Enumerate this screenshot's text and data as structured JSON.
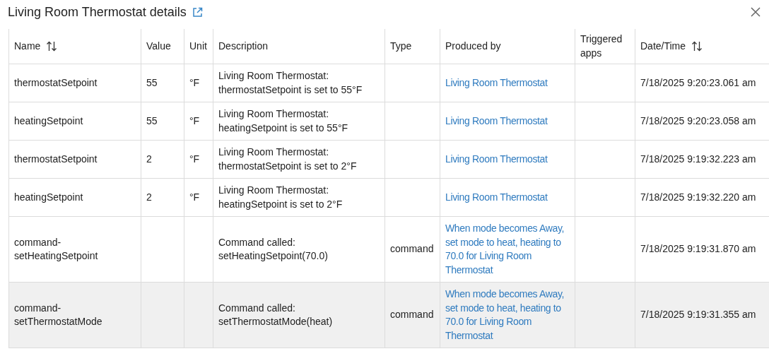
{
  "dialog": {
    "title": "Living Room Thermostat details"
  },
  "table": {
    "columns": [
      {
        "label": "Name",
        "sortable": true
      },
      {
        "label": "Value",
        "sortable": false
      },
      {
        "label": "Unit",
        "sortable": false
      },
      {
        "label": "Description",
        "sortable": false
      },
      {
        "label": "Type",
        "sortable": false
      },
      {
        "label": "Produced by",
        "sortable": false
      },
      {
        "label": "Triggered apps",
        "sortable": false
      },
      {
        "label": "Date/Time",
        "sortable": true
      }
    ],
    "rows": [
      {
        "name": "thermostatSetpoint",
        "value": "55",
        "unit": "°F",
        "description": "Living Room Thermostat: thermostatSetpoint is set to 55°F",
        "type": "",
        "produced_by": "Living Room Thermostat",
        "date_time": "7/18/2025 9:20:23.061 am",
        "highlighted": false
      },
      {
        "name": "heatingSetpoint",
        "value": "55",
        "unit": "°F",
        "description": "Living Room Thermostat: heatingSetpoint is set to 55°F",
        "type": "",
        "produced_by": "Living Room Thermostat",
        "date_time": "7/18/2025 9:20:23.058 am",
        "highlighted": false
      },
      {
        "name": "thermostatSetpoint",
        "value": "2",
        "unit": "°F",
        "description": "Living Room Thermostat: thermostatSetpoint is set to 2°F",
        "type": "",
        "produced_by": "Living Room Thermostat",
        "date_time": "7/18/2025 9:19:32.223 am",
        "highlighted": false
      },
      {
        "name": "heatingSetpoint",
        "value": "2",
        "unit": "°F",
        "description": "Living Room Thermostat: heatingSetpoint is set to 2°F",
        "type": "",
        "produced_by": "Living Room Thermostat",
        "date_time": "7/18/2025 9:19:32.220 am",
        "highlighted": false
      },
      {
        "name": "command-setHeatingSetpoint",
        "value": "",
        "unit": "",
        "description": "Command called: setHeatingSetpoint(70.0)",
        "type": "command",
        "produced_by": "When mode becomes Away, set mode to heat, heating to 70.0 for Living Room Thermostat",
        "date_time": "7/18/2025 9:19:31.870 am",
        "highlighted": false
      },
      {
        "name": "command-setThermostatMode",
        "value": "",
        "unit": "",
        "description": "Command called: setThermostatMode(heat)",
        "type": "command",
        "produced_by": "When mode becomes Away, set mode to heat, heating to 70.0 for Living Room Thermostat",
        "date_time": "7/18/2025 9:19:31.355 am",
        "highlighted": true
      }
    ]
  }
}
